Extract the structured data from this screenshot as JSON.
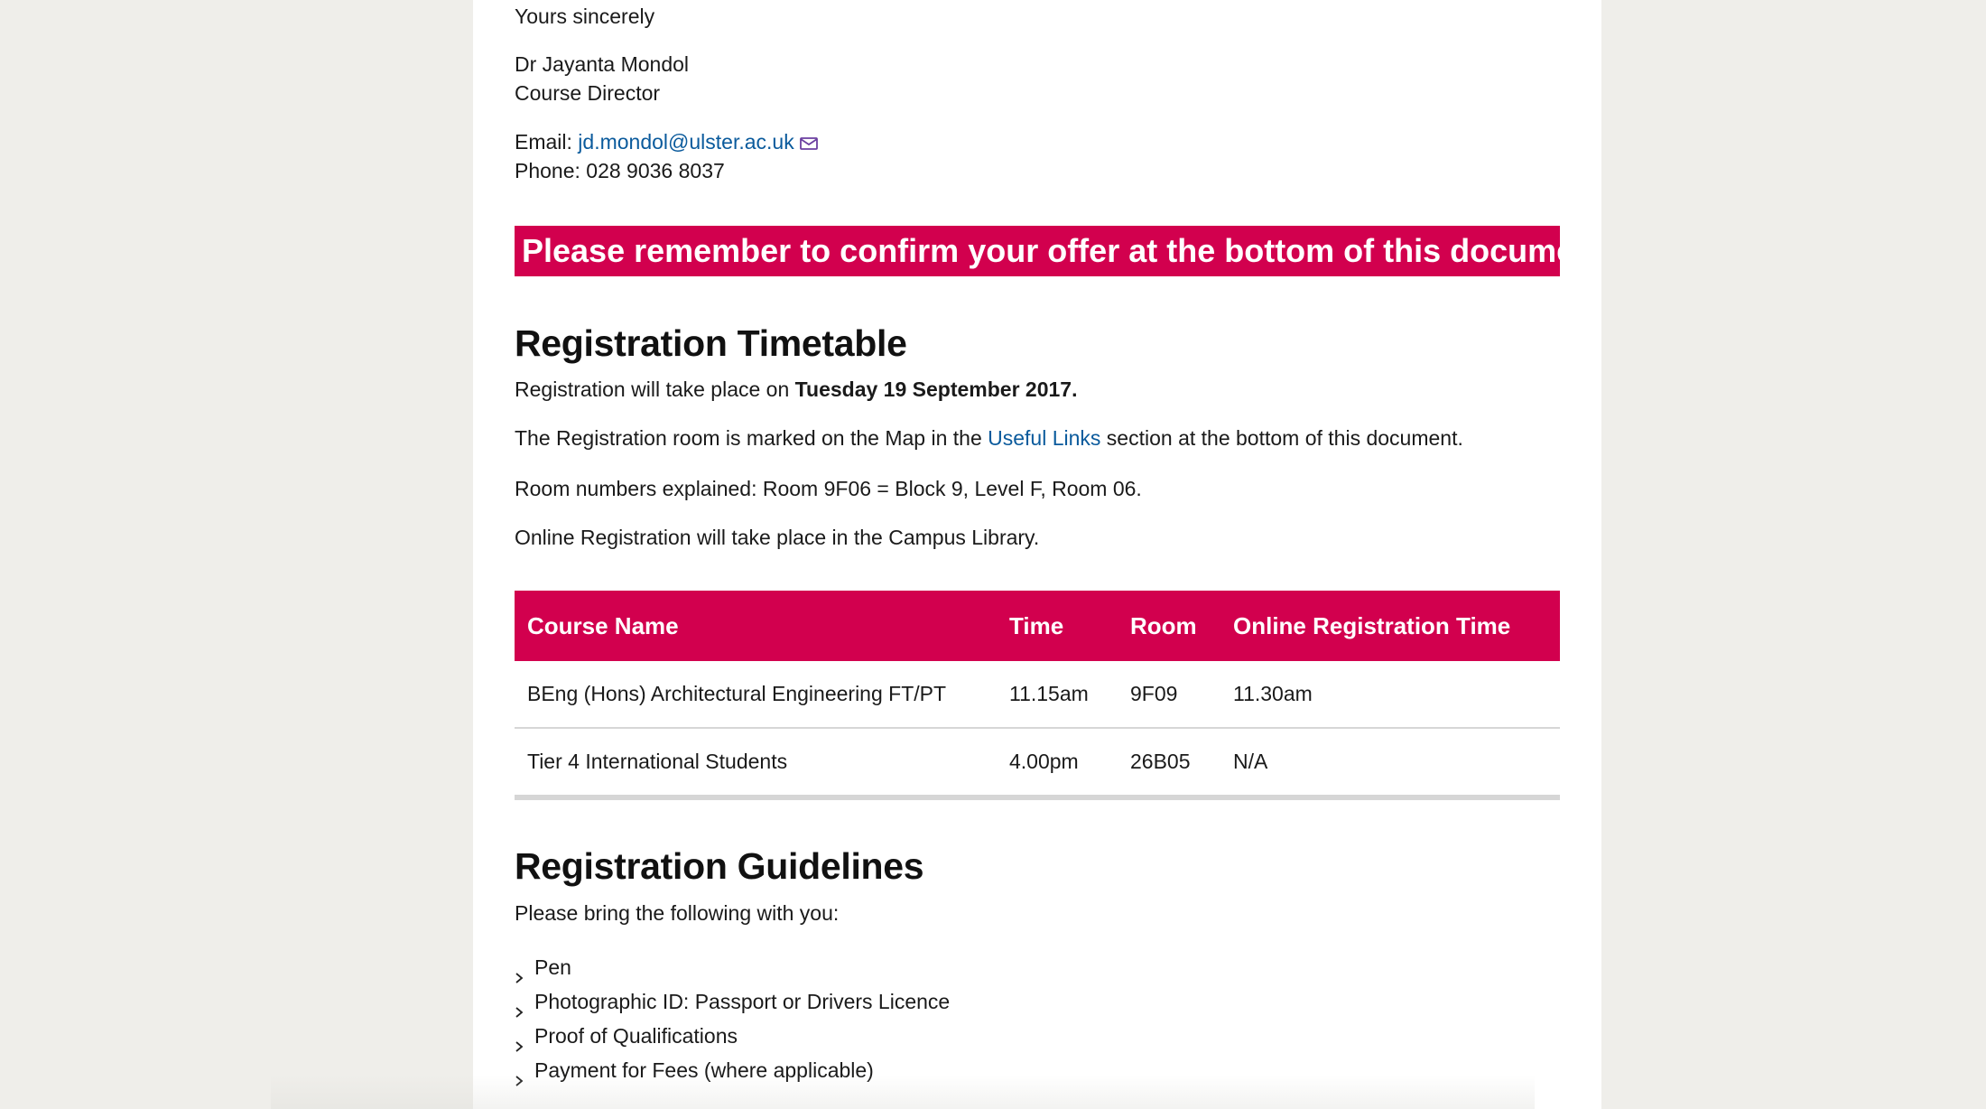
{
  "signoff": {
    "closing": "Yours sincerely",
    "name": "Dr Jayanta Mondol",
    "title": "Course Director",
    "email_label": "Email:",
    "email": "jd.mondol@ulster.ac.uk",
    "phone": "Phone: 028 9036 8037"
  },
  "banner": "Please remember to confirm your offer at the bottom of this document!",
  "timetable_section": {
    "heading": "Registration Timetable",
    "date_prefix": "Registration will take place on ",
    "date_bold": "Tuesday 19 September 2017.",
    "map_prefix": "The Registration room is marked on the Map in the ",
    "map_link": "Useful Links",
    "map_suffix": " section at the bottom of this document.",
    "room_explained": "Room numbers explained: Room 9F06 = Block 9, Level F, Room 06.",
    "online_note": "Online Registration will take place in the Campus Library."
  },
  "table": {
    "headers": [
      "Course Name",
      "Time",
      "Room",
      "Online Registration Time"
    ],
    "rows": [
      [
        "BEng (Hons) Architectural Engineering FT/PT",
        "11.15am",
        "9F09",
        "11.30am"
      ],
      [
        "Tier 4 International Students",
        "4.00pm",
        "26B05",
        "N/A"
      ]
    ]
  },
  "guidelines_section": {
    "heading": "Registration Guidelines",
    "intro": "Please bring the following with you:",
    "items": [
      "Pen",
      "Photographic ID: Passport or Drivers Licence",
      "Proof of Qualifications",
      "Payment for Fees (where applicable)"
    ]
  },
  "colors": {
    "accent": "#d2004e",
    "link": "#0a5a9c",
    "background": "#efeeea"
  },
  "icons": {
    "email": "envelope-icon",
    "list_bullet": "chevron-right-icon"
  }
}
